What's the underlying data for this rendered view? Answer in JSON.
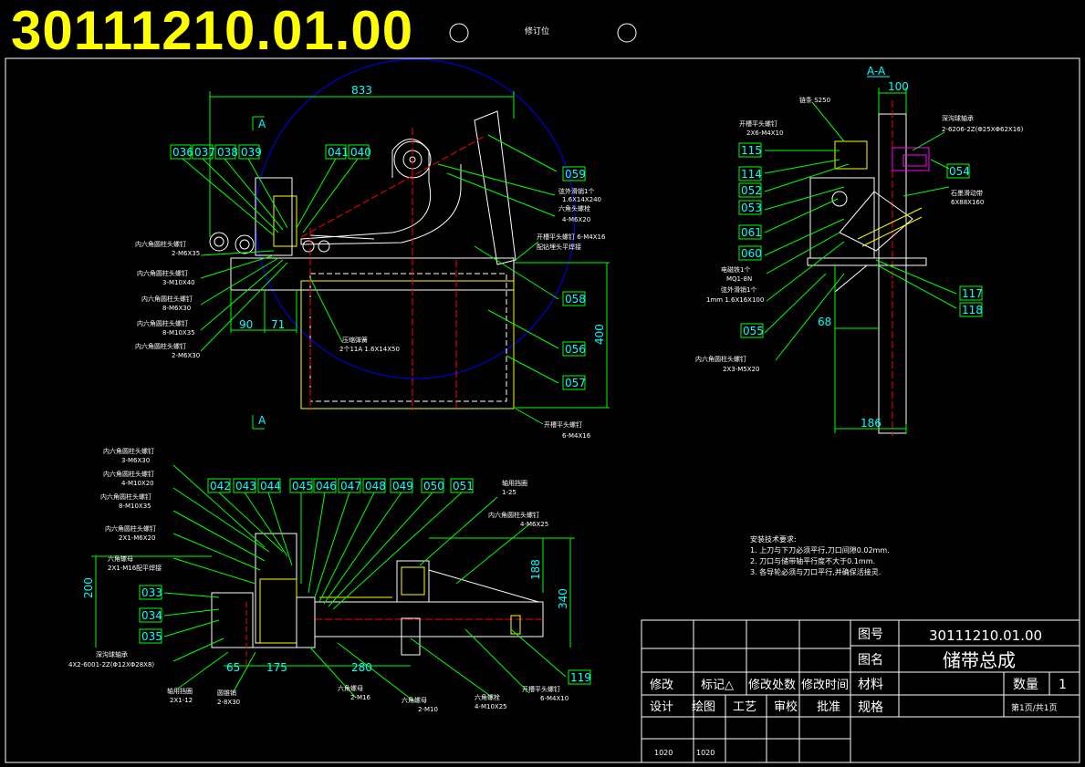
{
  "drawing_number_large": "30111210.01.00",
  "header_small_text": "修订位",
  "section_view": {
    "label": "A-A",
    "width_dim": "100",
    "dims": [
      "68",
      "186"
    ],
    "callouts": [
      "115",
      "114",
      "052",
      "053",
      "061",
      "060",
      "055",
      "054",
      "117",
      "118"
    ],
    "notes": [
      {
        "text": "链条 S250"
      },
      {
        "text": "开槽平头螺钉"
      },
      {
        "text": "2X6-M4X10"
      },
      {
        "text": "深沟球轴承"
      },
      {
        "text": "2-6206-2Z(Φ25XΦ62X16)"
      },
      {
        "text": "石墨滑动带"
      },
      {
        "text": "6X88X160"
      },
      {
        "text": "电磁铁1个"
      },
      {
        "text": "MQ1-8N"
      },
      {
        "text": "弦外滑销1个"
      },
      {
        "text": "1mm 1.6X16X100"
      },
      {
        "text": "内六角圆柱头螺钉"
      },
      {
        "text": "2X3-M5X20"
      }
    ]
  },
  "front_view": {
    "section_mark": "A",
    "dims": [
      "833",
      "90",
      "71",
      "400"
    ],
    "callouts_top": [
      "036",
      "037",
      "038",
      "039",
      "041",
      "040"
    ],
    "callouts_right": [
      "059",
      "058",
      "056",
      "057"
    ],
    "notes": [
      {
        "text": "弦外滑销1个"
      },
      {
        "text": "1.6X14X240"
      },
      {
        "text": "六角头螺栓"
      },
      {
        "text": "4-M6X20"
      },
      {
        "text": "开槽平头螺钉 6-M4X16"
      },
      {
        "text": "配钻埋头平焊接"
      },
      {
        "text": "内六角圆柱头螺钉"
      },
      {
        "text": "2-M6X35"
      },
      {
        "text": "内六角圆柱头螺钉"
      },
      {
        "text": "3-M10X40"
      },
      {
        "text": "内六角圆柱头螺钉"
      },
      {
        "text": "8-M6X30"
      },
      {
        "text": "内六角圆柱头螺钉"
      },
      {
        "text": "8-M10X35"
      },
      {
        "text": "内六角圆柱头螺钉"
      },
      {
        "text": "2-M6X30"
      },
      {
        "text": "压缩弹簧"
      },
      {
        "text": "2个11A 1.6X14X50"
      },
      {
        "text": "开槽平头螺钉"
      },
      {
        "text": "6-M4X16"
      }
    ]
  },
  "bottom_view": {
    "dims": [
      "200",
      "65",
      "175",
      "280",
      "188",
      "340"
    ],
    "callouts_top": [
      "042",
      "043",
      "044",
      "045",
      "046",
      "047",
      "048",
      "049",
      "050",
      "051"
    ],
    "callouts_left": [
      "033",
      "034",
      "035"
    ],
    "callout_right": "119",
    "notes": [
      {
        "text": "内六角圆柱头螺钉"
      },
      {
        "text": "3-M6X30"
      },
      {
        "text": "内六角圆柱头螺钉"
      },
      {
        "text": "4-M10X20"
      },
      {
        "text": "内六角圆柱头螺钉"
      },
      {
        "text": "8-M10X35"
      },
      {
        "text": "内六角圆柱头螺钉"
      },
      {
        "text": "2X1-M6X20"
      },
      {
        "text": "六角螺母"
      },
      {
        "text": "2X1-M16配平焊接"
      },
      {
        "text": "深沟球轴承"
      },
      {
        "text": "4X2-6001-2Z(Φ12XΦ28X8)"
      },
      {
        "text": "轴用挡圈"
      },
      {
        "text": "2X1-12"
      },
      {
        "text": "圆锥销"
      },
      {
        "text": "2-8X30"
      },
      {
        "text": "六角螺母"
      },
      {
        "text": "2-M16"
      },
      {
        "text": "六角螺母"
      },
      {
        "text": "2-M10"
      },
      {
        "text": "六角螺栓"
      },
      {
        "text": "4-M10X25"
      },
      {
        "text": "开槽平头螺钉"
      },
      {
        "text": "6-M4X10"
      },
      {
        "text": "轴用挡圈"
      },
      {
        "text": "1-25"
      },
      {
        "text": "内六角圆柱头螺钉"
      },
      {
        "text": "4-M6X25"
      }
    ]
  },
  "tech_requirements": {
    "title": "安装技术要求:",
    "lines": [
      "1. 上刀与下刀必须平行,刀口间隙0.02mm.",
      "2. 刀口与储带轴平行度不大于0.1mm.",
      "3. 各导轮必须与刀口平行,并确保活接灵."
    ]
  },
  "title_block": {
    "label_drawing_no": "图号",
    "drawing_no": "30111210.01.00",
    "label_name": "图名",
    "name": "储带总成",
    "label_material": "材料",
    "label_qty": "数量",
    "qty": "1",
    "label_spec": "规格",
    "page": "第1页/共1页",
    "row_mod": [
      "修改",
      "标记△",
      "修改处数",
      "修改时间"
    ],
    "row_sign": [
      "设计",
      "绘图",
      "工艺",
      "审校",
      "批准"
    ],
    "values": [
      "1020",
      "1020"
    ]
  }
}
